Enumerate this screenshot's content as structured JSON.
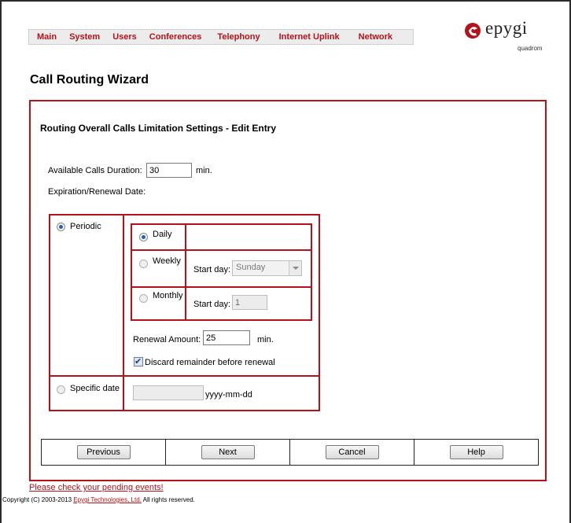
{
  "nav": {
    "items": [
      "Main",
      "System",
      "Users",
      "Conferences",
      "Telephony",
      "Internet Uplink",
      "Network"
    ]
  },
  "logo": {
    "brand": "epygi",
    "sub": "quadrom"
  },
  "page": {
    "title": "Call Routing Wizard"
  },
  "section": {
    "title": "Routing Overall Calls Limitation Settings - Edit Entry"
  },
  "form": {
    "duration_label": "Available Calls Duration:",
    "duration_value": "30",
    "duration_unit": "min.",
    "expiration_label": "Expiration/Renewal Date:",
    "periodic_label": "Periodic",
    "daily_label": "Daily",
    "weekly_label": "Weekly",
    "weekly_start_label": "Start day:",
    "weekly_start_value": "Sunday",
    "monthly_label": "Monthly",
    "monthly_start_label": "Start day:",
    "monthly_start_value": "1",
    "renewal_label": "Renewal Amount:",
    "renewal_value": "25",
    "renewal_unit": "min.",
    "discard_label": "Discard remainder before renewal",
    "specific_label": "Specific date",
    "specific_value": "",
    "specific_format": "yyyy-mm-dd"
  },
  "buttons": {
    "previous": "Previous",
    "next": "Next",
    "cancel": "Cancel",
    "help": "Help"
  },
  "footer": {
    "pending": "Please check your pending events!",
    "copyright_pre": "Copyright (C) 2003-2013 ",
    "copyright_link": "Epygi Technologies, Ltd.",
    "copyright_post": " All rights reserved."
  },
  "colors": {
    "accent": "#b5121b",
    "radio": "#2d5fa8"
  }
}
